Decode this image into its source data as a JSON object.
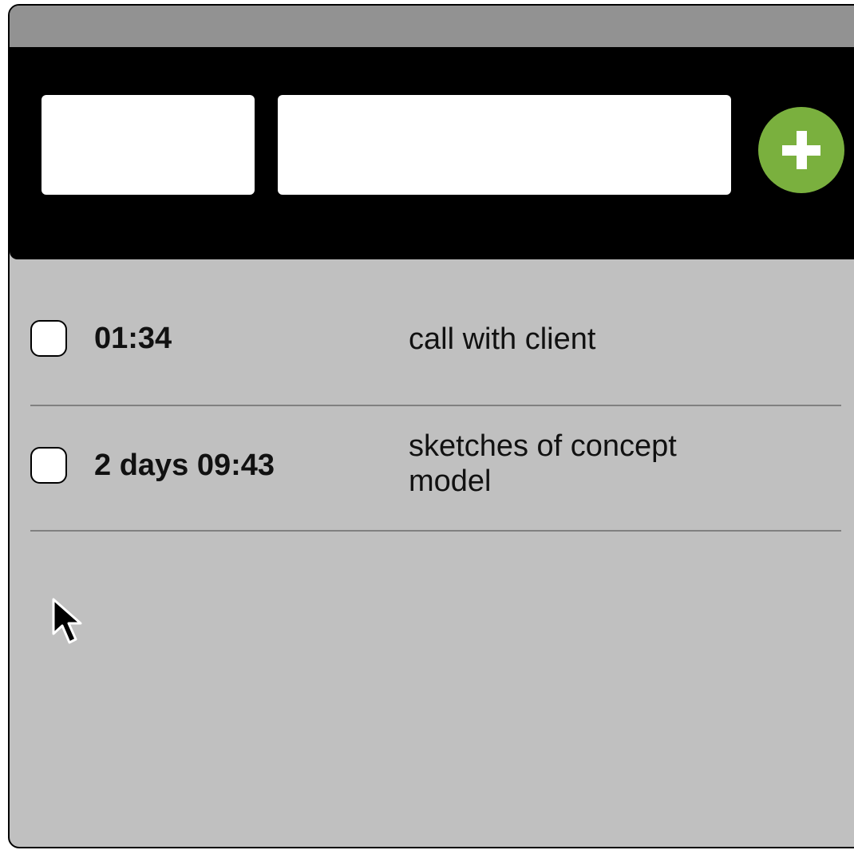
{
  "header": {
    "time_input": {
      "value": "",
      "placeholder": ""
    },
    "task_input": {
      "value": "",
      "placeholder": ""
    },
    "add_button": {
      "icon": "plus-icon",
      "color": "#7ab03e"
    }
  },
  "entries": [
    {
      "elapsed": "01:34",
      "task": "call with client",
      "checked": false
    },
    {
      "elapsed": "2 days 09:43",
      "task": "sketches of concept model",
      "checked": false
    }
  ],
  "colors": {
    "titlebar": "#929292",
    "header": "#000000",
    "list_background": "#c0c0c0",
    "divider": "#808080",
    "accent": "#7ab03e"
  }
}
